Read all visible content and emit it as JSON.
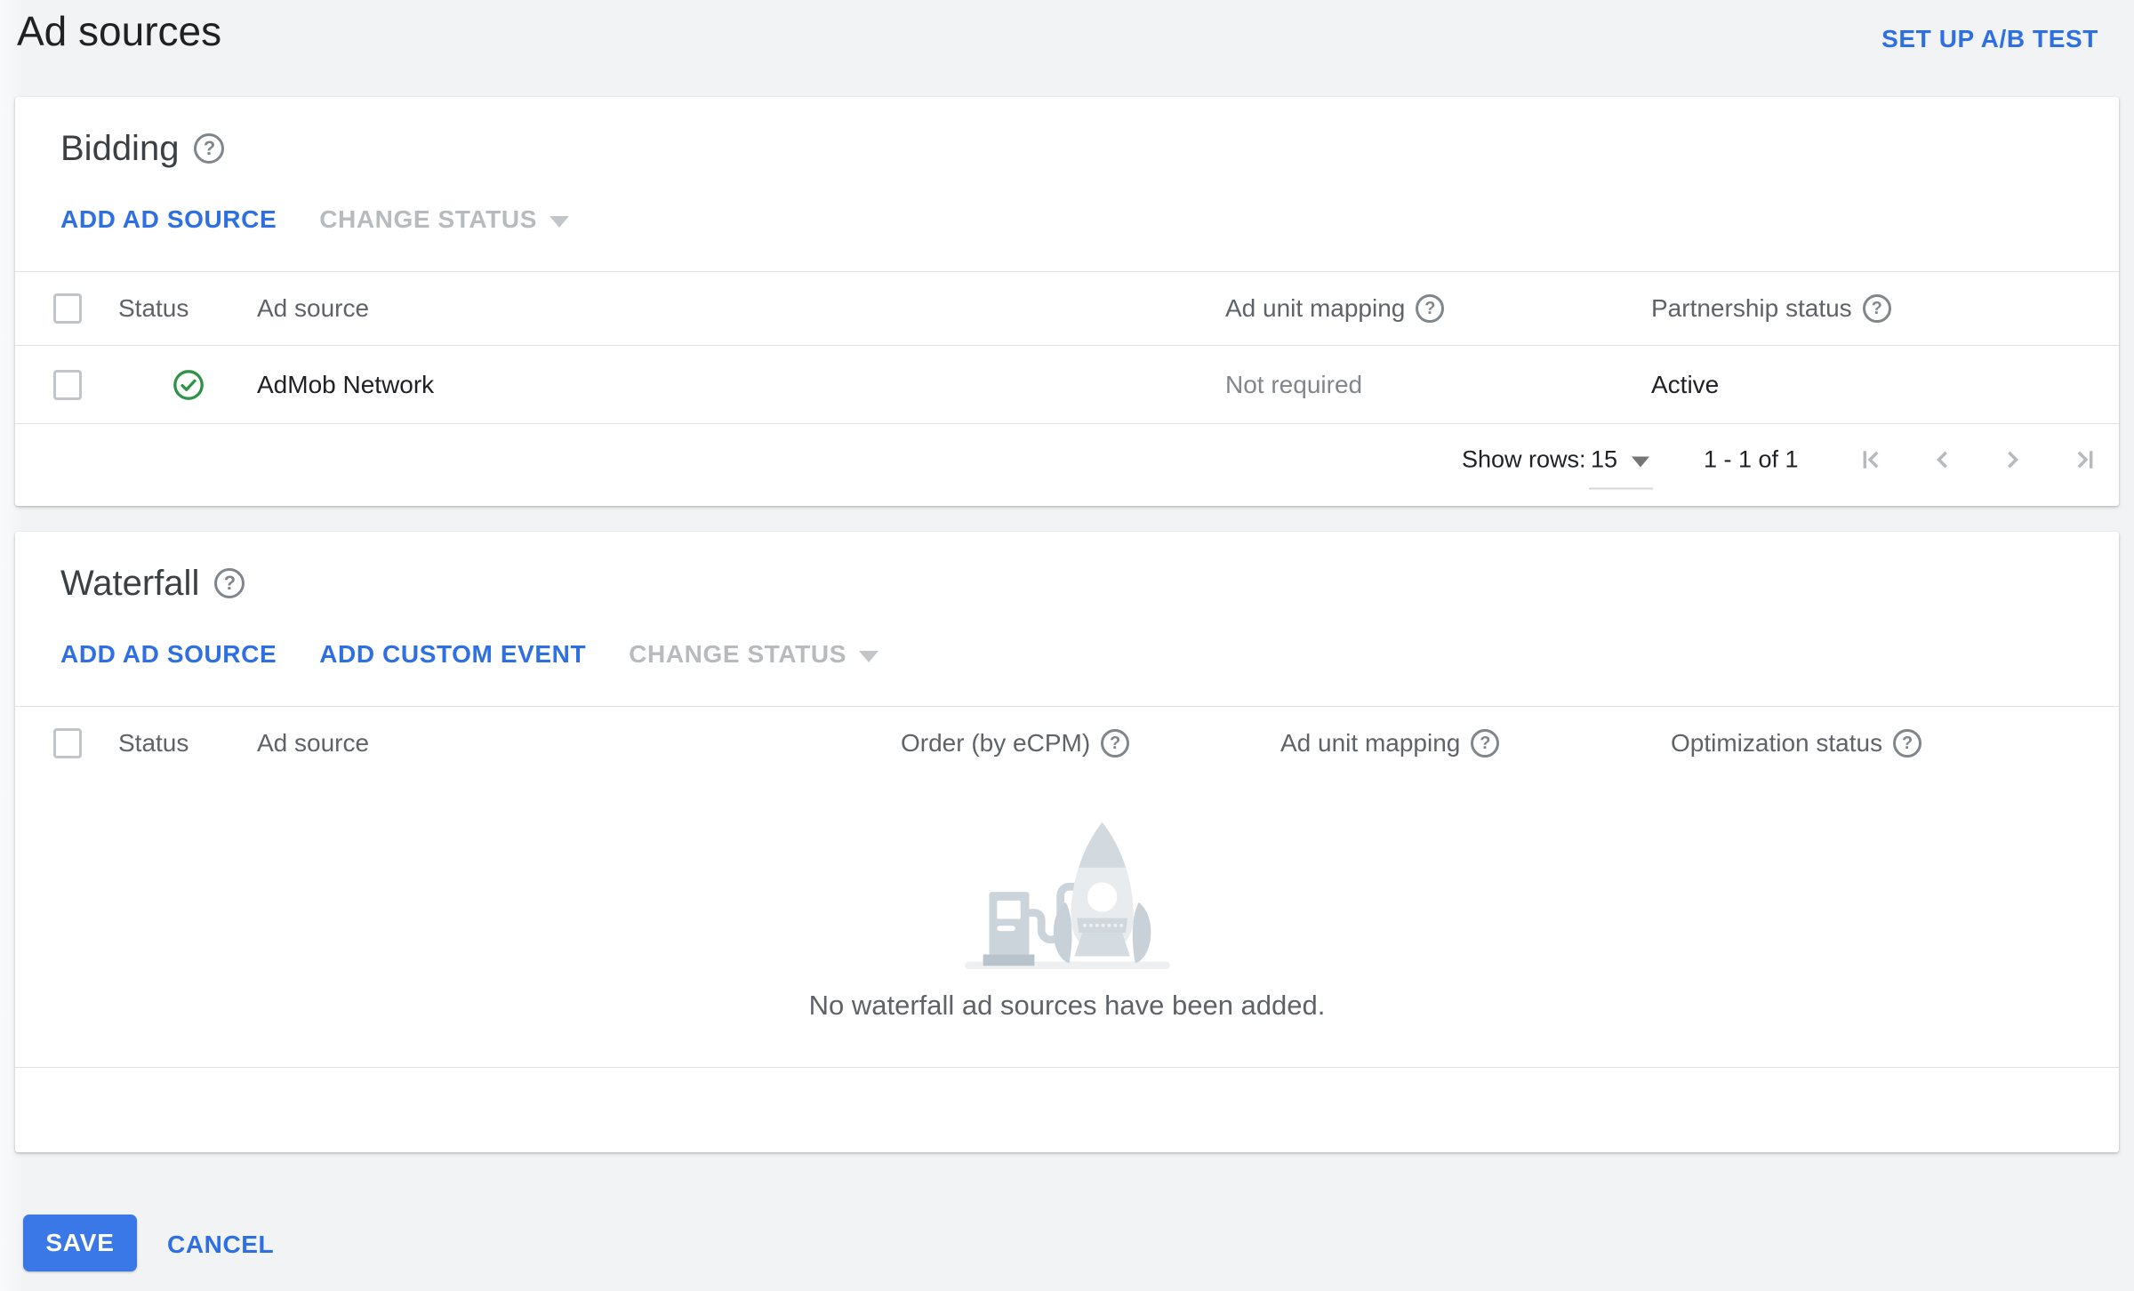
{
  "page": {
    "title": "Ad sources",
    "setup_ab_test_label": "SET UP A/B TEST"
  },
  "colors": {
    "accent_blue": "#2e6fe3",
    "button_blue": "#3b78e7",
    "success_green": "#2e9247",
    "disabled_gray": "#b8bbbe",
    "page_background": "#f1f3f4"
  },
  "icons": {
    "help_glyph": "?"
  },
  "bidding": {
    "title": "Bidding",
    "actions": {
      "add_ad_source": "ADD AD SOURCE",
      "change_status": "CHANGE STATUS"
    },
    "table": {
      "headers": {
        "status": "Status",
        "ad_source": "Ad source",
        "ad_unit_mapping": "Ad unit mapping",
        "partnership_status": "Partnership status"
      },
      "rows": [
        {
          "status_icon": "check-circle",
          "ad_source": "AdMob Network",
          "ad_unit_mapping": "Not required",
          "partnership_status": "Active"
        }
      ]
    },
    "pagination": {
      "show_rows_label": "Show rows:",
      "rows_per_page": "15",
      "range_label": "1 - 1 of 1"
    }
  },
  "waterfall": {
    "title": "Waterfall",
    "actions": {
      "add_ad_source": "ADD AD SOURCE",
      "add_custom_event": "ADD CUSTOM EVENT",
      "change_status": "CHANGE STATUS"
    },
    "table": {
      "headers": {
        "status": "Status",
        "ad_source": "Ad source",
        "order_by_ecpm": "Order (by eCPM)",
        "ad_unit_mapping": "Ad unit mapping",
        "optimization_status": "Optimization status"
      }
    },
    "empty_message": "No waterfall ad sources have been added."
  },
  "footer": {
    "save_label": "SAVE",
    "cancel_label": "CANCEL"
  }
}
